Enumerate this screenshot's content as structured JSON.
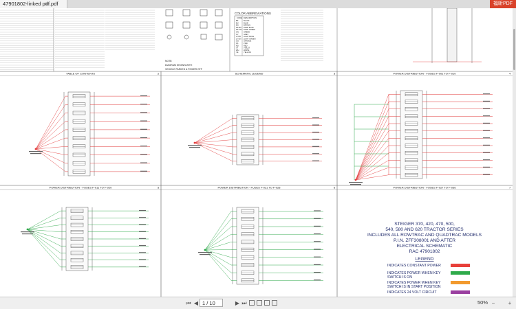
{
  "tab": {
    "filename": "47901802-linked pdf.pdf",
    "close": "×"
  },
  "brand": {
    "label": "福昕PDF"
  },
  "sheets": [
    {
      "title": "TABLE OF CONTENTS",
      "number": "2"
    },
    {
      "title": "SCHEMATIC LEGEND",
      "number": "3"
    },
    {
      "title": "POWER DISTRIBUTION - FUSES F-001 TO F-010",
      "number": "4"
    },
    {
      "title": "POWER DISTRIBUTION - FUSES F-011 TO F-020",
      "number": "5"
    },
    {
      "title": "POWER DISTRIBUTION - FUSES F-021 TO F-028",
      "number": "6"
    },
    {
      "title": "POWER DISTRIBUTION - FUSES F-027 TO F-036",
      "number": "7"
    }
  ],
  "color_abbr": {
    "title": "COLOR ABBREVIATIONS",
    "header_code": "CODE",
    "header_desc": "DESCRIPTION",
    "rows": [
      [
        "BK",
        "BLACK"
      ],
      [
        "BU",
        "BLUE"
      ],
      [
        "BN",
        "BROWN"
      ],
      [
        "DK BU",
        "DARK BLUE"
      ],
      [
        "DK GN",
        "DARK GREEN"
      ],
      [
        "GN",
        "GREEN"
      ],
      [
        "GY",
        "GREY"
      ],
      [
        "LT BU",
        "LIGHT BLUE"
      ],
      [
        "LT GN",
        "LIGHT GREEN"
      ],
      [
        "OG",
        "ORANGE"
      ],
      [
        "PK",
        "PINK"
      ],
      [
        "RD",
        "RED"
      ],
      [
        "VT",
        "VIOLET"
      ],
      [
        "WH",
        "WHITE"
      ],
      [
        "YE",
        "YELLOW"
      ]
    ]
  },
  "note": {
    "line1": "NOTE:",
    "line2": "DIAGRAM SHOWN WITH",
    "line3": "VEHICLE PARKED & POWER OFF"
  },
  "title_block": {
    "lines": [
      "STEIGER 370, 420, 470, 500,",
      "540, 580 AND 620 TRACTOR SERIES",
      "INCLUDES ALL ROWTRAC AND QUADTRAC MODELS",
      "P.I.N. ZFF308001 AND AFTER",
      "ELECTRICAL SCHEMATIC",
      "RAC 47901802"
    ],
    "legend_title": "LEGEND",
    "legend": [
      {
        "text1": "INDICATES CONSTANT POWER",
        "text2": "",
        "color": "#e8403a"
      },
      {
        "text1": "INDICATES POWER WHEN KEY",
        "text2": "SWITCH IS ON",
        "color": "#2eaa4a"
      },
      {
        "text1": "INDICATES POWER WHEN KEY",
        "text2": "SWITCH IS IN START POSITION",
        "color": "#f29a2e"
      },
      {
        "text1": "INDICATES 24 VOLT CIRCUIT",
        "text2": "",
        "color": "#9a3fa0"
      }
    ]
  },
  "statusbar": {
    "page_current": "1 / 10",
    "page_total": "",
    "zoom": "50%"
  },
  "colors": {
    "red": "#e23b3b",
    "green": "#2ea84a",
    "dark": "#333333"
  }
}
